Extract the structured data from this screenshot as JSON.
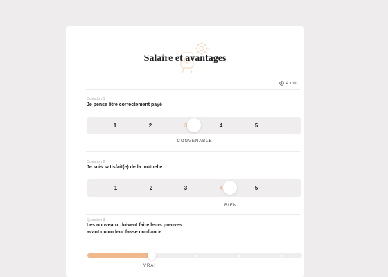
{
  "survey": {
    "title": "Salaire et avantages",
    "duration": "4 min",
    "accent_color": "#f0b98c"
  },
  "questions": [
    {
      "number": "Question 1",
      "text": "Je pense être correctement payé",
      "options": [
        "1",
        "2",
        "3",
        "4",
        "5"
      ],
      "selected": "3",
      "answer": "CONVENABLE"
    },
    {
      "number": "Question 2",
      "text": "Je suis satisfait(e) de la mutuelle",
      "options": [
        "1",
        "2",
        "3",
        "4",
        "5"
      ],
      "selected": "4",
      "answer": "BIEN"
    },
    {
      "number": "Question 3",
      "text_line1": "Les nouveaux doivent faire leurs preuves",
      "text_line2": "avant qu'on leur fasse confiance",
      "slider_value": 0.3,
      "answer": "VRAI"
    }
  ]
}
